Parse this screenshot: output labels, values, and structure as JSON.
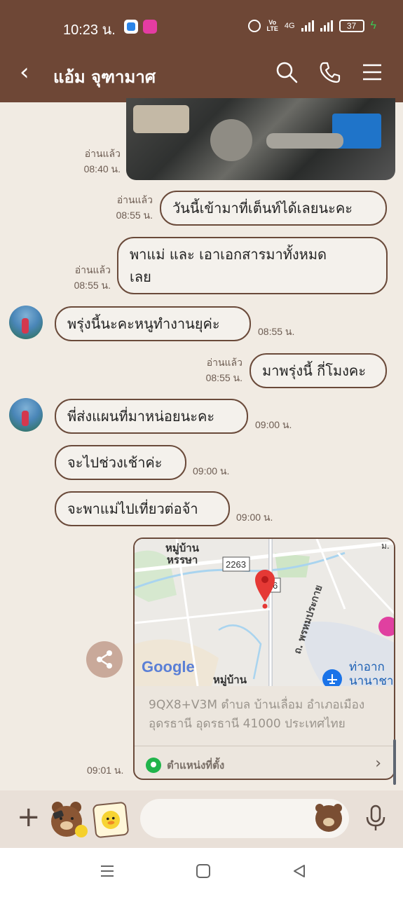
{
  "status_bar": {
    "time": "10:23 น.",
    "network": "4G",
    "battery": "37"
  },
  "header": {
    "back_glyph": "‹",
    "contact_name": "แอ้ม จุฑามาศ"
  },
  "messages": {
    "m0": {
      "read": "อ่านแล้ว",
      "time": "08:40 น."
    },
    "m1": {
      "text": "วันนี้เข้ามาที่เต็นท์ได้เลยนะคะ",
      "read": "อ่านแล้ว",
      "time": "08:55 น."
    },
    "m2": {
      "line1": "พาแม่ และ เอาเอกสารมาทั้งหมด",
      "line2": "เลย",
      "read": "อ่านแล้ว",
      "time": "08:55 น."
    },
    "m3": {
      "text": "พรุ่งนี้นะคะหนูทำงานยุค่ะ",
      "time": "08:55 น."
    },
    "m4": {
      "text": "มาพรุ่งนี้ กี่โมงคะ",
      "read": "อ่านแล้ว",
      "time": "08:55 น."
    },
    "m5": {
      "text": "พี่ส่งแผนที่มาหน่อยนะคะ",
      "time": "09:00 น."
    },
    "m6": {
      "text": "จะไปช่วงเช้าค่ะ",
      "time": "09:00 น."
    },
    "m7": {
      "text": "จะพาแม่ไปเที่ยวต่อจ้า",
      "time": "09:00 น."
    }
  },
  "location_message": {
    "time": "09:01 น.",
    "map_labels": {
      "village_top_1": "หมู่บ้าน",
      "village_top_2": "หรรษา",
      "road_number": "2263",
      "road_tag": "6",
      "road_name": "ถ. พรหมประกาย",
      "village_bottom": "หมู่บ้าน",
      "airport_1": "ท่าอาก",
      "airport_2": "นานาชา",
      "corner": "ม.",
      "google": "Google"
    },
    "address_line1": "9QX8+V3M ตำบล บ้านเลื่อม อำเภอเมือง",
    "address_line2": "อุดรธานี อุดรธานี 41000 ประเทศไทย",
    "label": "ตำแหน่งที่ตั้ง",
    "chevron": "›"
  },
  "input_bar": {
    "plus": "+",
    "placeholder": ""
  },
  "colors": {
    "header_bg": "#6e4736",
    "chat_bg": "#f1ebe3",
    "bubble_border": "#6a4a3a",
    "map_pin": "#e53935"
  },
  "icons": [
    "search-icon",
    "phone-icon",
    "menu-icon",
    "share-icon",
    "location-pin-icon",
    "mic-icon",
    "emoji-icon",
    "alarm-icon"
  ]
}
